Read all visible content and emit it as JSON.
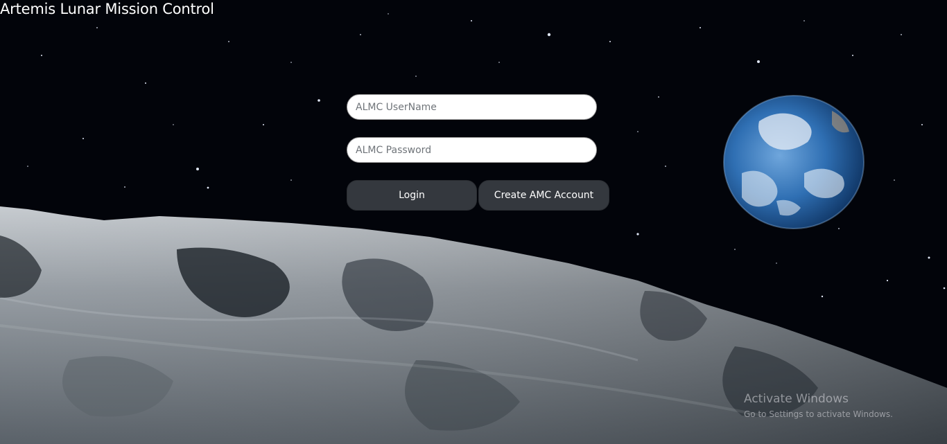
{
  "app": {
    "title": "Artemis Lunar Mission Control"
  },
  "background": {
    "scene": "lunar-surface-earthrise",
    "colors": {
      "space": "#02040a",
      "earth_ocean": "#2f6fb3",
      "moon_surface": "#8e959c"
    }
  },
  "login": {
    "username": {
      "placeholder": "ALMC UserName",
      "value": ""
    },
    "password": {
      "placeholder": "ALMC Password",
      "value": ""
    },
    "login_button": "Login",
    "create_account_button": "Create AMC Account",
    "button_color": "#34383e"
  },
  "system_watermark": {
    "title": "Activate Windows",
    "subtitle": "Go to Settings to activate Windows."
  }
}
